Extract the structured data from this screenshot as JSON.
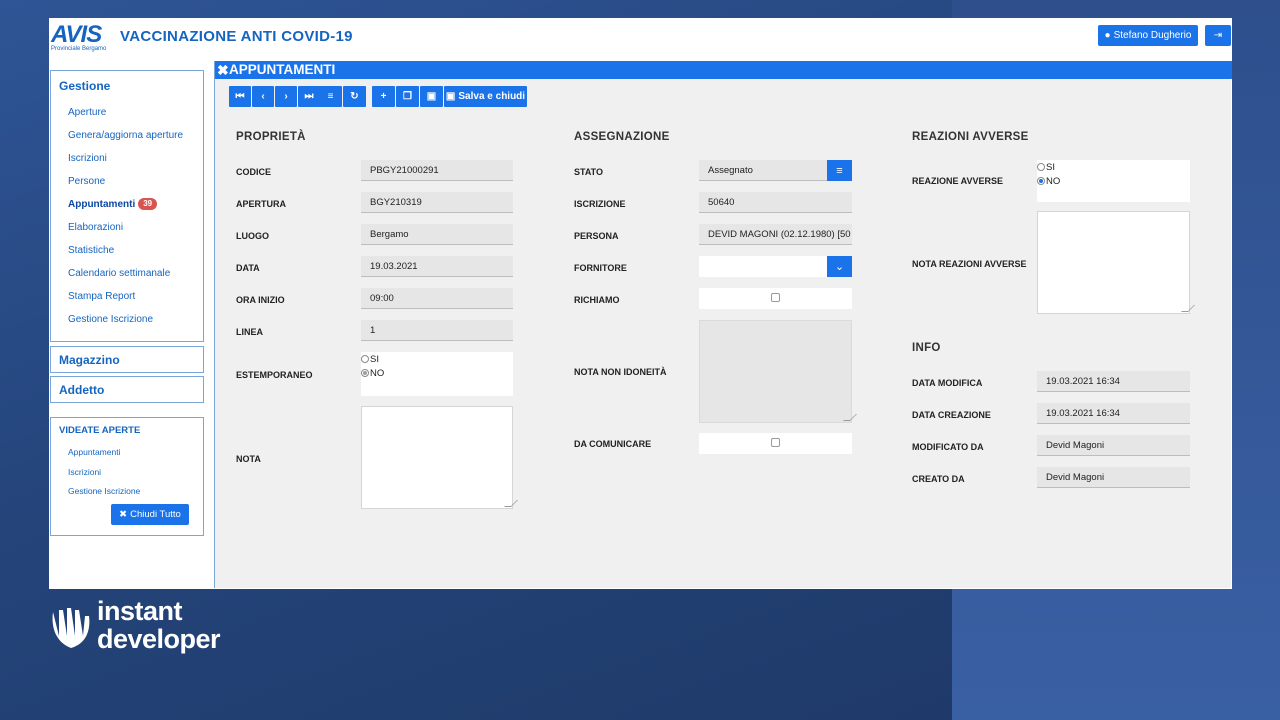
{
  "header": {
    "logo_text": "AVIS",
    "logo_subtitle": "Provinciale Bergamo",
    "title": "VACCINAZIONE ANTI COVID-19",
    "user_name": "Stefano Dugherio"
  },
  "sidebar": {
    "gestione": {
      "title": "Gestione",
      "items": [
        {
          "label": "Aperture"
        },
        {
          "label": "Genera/aggiorna aperture"
        },
        {
          "label": "Iscrizioni"
        },
        {
          "label": "Persone"
        },
        {
          "label": "Appuntamenti",
          "badge": "39"
        },
        {
          "label": "Elaborazioni"
        },
        {
          "label": "Statistiche"
        },
        {
          "label": "Calendario settimanale"
        },
        {
          "label": "Stampa Report"
        },
        {
          "label": "Gestione Iscrizione"
        }
      ]
    },
    "magazzino": "Magazzino",
    "addetto": "Addetto",
    "open_views": {
      "title": "VIDEATE APERTE",
      "items": [
        "Appuntamenti",
        "Iscrizioni",
        "Gestione Iscrizione"
      ],
      "close_all": "Chiudi Tutto"
    }
  },
  "main": {
    "title": "APPUNTAMENTI",
    "save_close": "Salva e chiudi"
  },
  "properties": {
    "title": "PROPRIETÀ",
    "codice_label": "CODICE",
    "codice": "PBGY21000291",
    "apertura_label": "APERTURA",
    "apertura": "BGY210319",
    "luogo_label": "LUOGO",
    "luogo": "Bergamo",
    "data_label": "DATA",
    "data": "19.03.2021",
    "ora_label": "ORA INIZIO",
    "ora": "09:00",
    "linea_label": "LINEA",
    "linea": "1",
    "estemporaneo_label": "ESTEMPORANEO",
    "opt_si": "SI",
    "opt_no": "NO",
    "nota_label": "NOTA"
  },
  "assignment": {
    "title": "ASSEGNAZIONE",
    "stato_label": "STATO",
    "stato": "Assegnato",
    "iscrizione_label": "ISCRIZIONE",
    "iscrizione": "50640",
    "persona_label": "PERSONA",
    "persona": "DEVID MAGONI (02.12.1980) [50",
    "fornitore_label": "FORNITORE",
    "richiamo_label": "RICHIAMO",
    "nota_non_idoneita_label": "NOTA NON IDONEITÀ",
    "da_comunicare_label": "DA COMUNICARE"
  },
  "adverse": {
    "title": "REAZIONI AVVERSE",
    "reazione_label": "REAZIONE AVVERSE",
    "opt_si": "SI",
    "opt_no": "NO",
    "nota_label": "NOTA REAZIONI AVVERSE"
  },
  "info": {
    "title": "INFO",
    "data_modifica_label": "DATA MODIFICA",
    "data_modifica": "19.03.2021 16:34",
    "data_creazione_label": "DATA CREAZIONE",
    "data_creazione": "19.03.2021 16:34",
    "modificato_da_label": "MODIFICATO DA",
    "modificato_da": "Devid Magoni",
    "creato_da_label": "CREATO DA",
    "creato_da": "Devid Magoni"
  },
  "branding": {
    "line1": "instant",
    "line2": "developer"
  },
  "colors": {
    "accent": "#1a73e8",
    "badge": "#d9534f",
    "background": "#24447a"
  }
}
